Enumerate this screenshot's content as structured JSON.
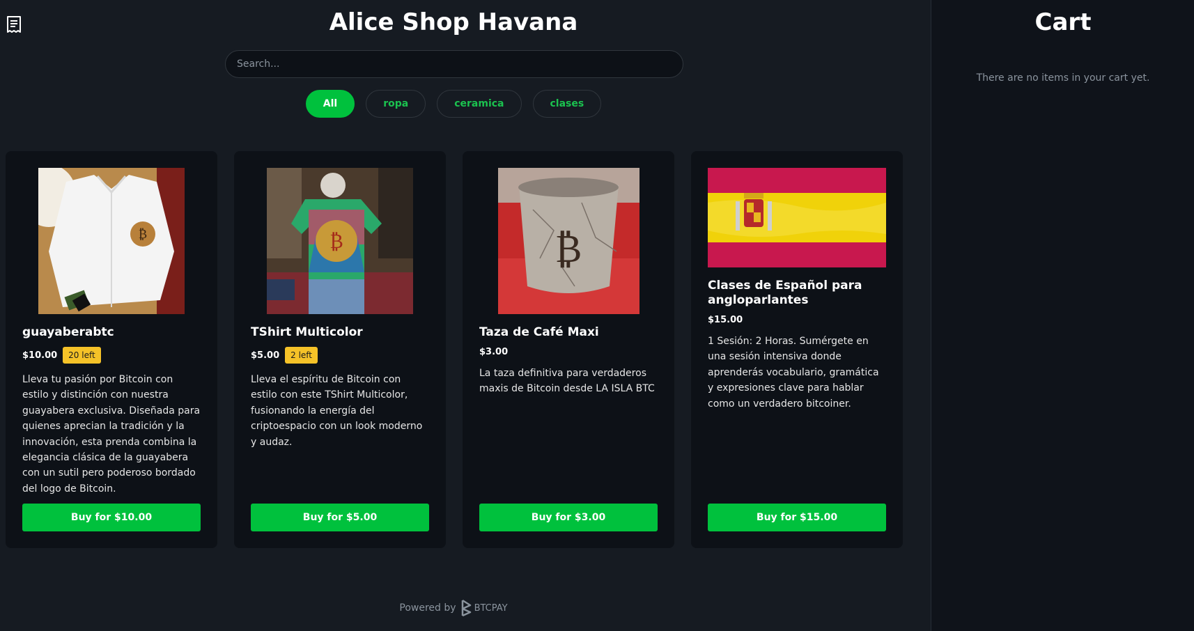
{
  "shop": {
    "title": "Alice Shop Havana"
  },
  "search": {
    "placeholder": "Search..."
  },
  "filters": [
    {
      "label": "All",
      "active": true
    },
    {
      "label": "ropa",
      "active": false
    },
    {
      "label": "ceramica",
      "active": false
    },
    {
      "label": "clases",
      "active": false
    }
  ],
  "products": [
    {
      "title": "guayaberabtc",
      "price": "$10.00",
      "stock": "20 left",
      "description": "Lleva tu pasión por Bitcoin con estilo y distinción con nuestra guayabera exclusiva. Diseñada para quienes aprecian la tradición y la innovación, esta prenda combina la elegancia clásica de la guayabera con un sutil pero poderoso bordado del logo de Bitcoin.",
      "buy_label": "Buy for $10.00"
    },
    {
      "title": "TShirt Multicolor",
      "price": "$5.00",
      "stock": "2 left",
      "description": "Lleva el espíritu de Bitcoin con estilo con este TShirt Multicolor, fusionando la energía del criptoespacio con un look moderno y audaz.",
      "buy_label": "Buy for $5.00"
    },
    {
      "title": "Taza de Café Maxi",
      "price": "$3.00",
      "stock": "",
      "description": "La taza definitiva para verdaderos maxis de Bitcoin desde LA ISLA BTC",
      "buy_label": "Buy for $3.00"
    },
    {
      "title": "Clases de Español para angloparlantes",
      "price": "$15.00",
      "stock": "",
      "description": "1 Sesión: 2 Horas. Sumérgete en una sesión intensiva donde aprenderás vocabulario, gramática y expresiones clave para hablar como un verdadero bitcoiner.",
      "buy_label": "Buy for $15.00"
    }
  ],
  "footer": {
    "powered_by": "Powered by",
    "brand": "BTCPAY"
  },
  "cart": {
    "title": "Cart",
    "empty_message": "There are no items in your cart yet."
  },
  "colors": {
    "accent": "#00c13d",
    "badge": "#f5c228",
    "background": "#161b22",
    "card": "#0d1117"
  }
}
